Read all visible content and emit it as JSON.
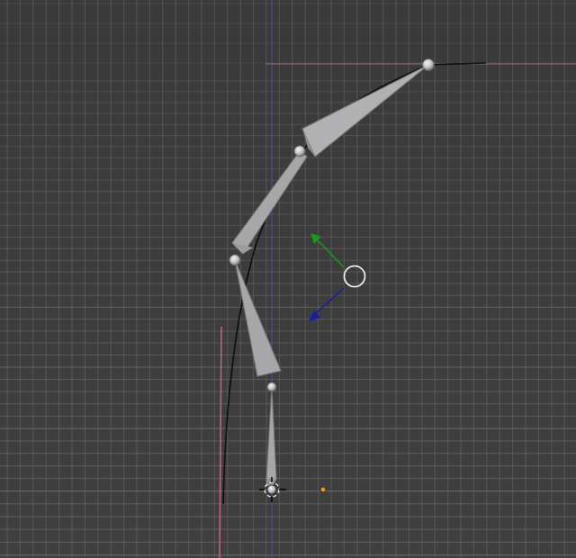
{
  "viewport": {
    "view": "perspective",
    "background_color": "#393939",
    "grid": {
      "visible": true,
      "minor_line_color": "#5f5f5f",
      "major_line_color": "#6c6c6c"
    },
    "axes": {
      "x_axis_color": "#a66a6a",
      "z_axis_color": "#4a4fa8"
    }
  },
  "armature": {
    "bone_color": "#a7a7a9",
    "bone_edge_color": "#7c7c7e",
    "joint_color": "#c9c9cb",
    "bone_count": 4
  },
  "curve": {
    "visible": true,
    "color": "#0c0c0c"
  },
  "manipulator": {
    "y_axis_color": "#1a9a1a",
    "z_axis_color": "#1a1aa6",
    "circle_color": "#ffffff"
  },
  "cursor_3d": {
    "visible": true,
    "icon": "crosshair-icon"
  },
  "object_origin": {
    "color": "#e89a2a"
  }
}
